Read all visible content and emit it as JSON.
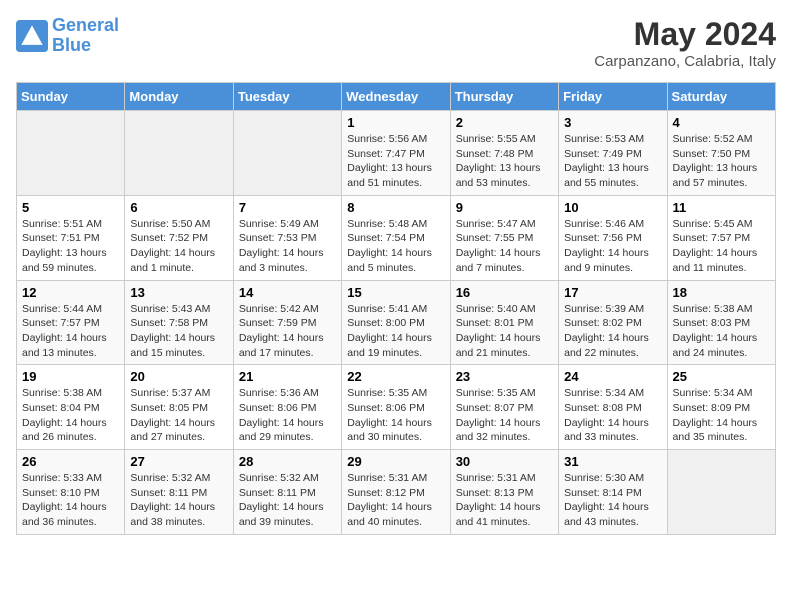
{
  "header": {
    "logo_line1": "General",
    "logo_line2": "Blue",
    "month_title": "May 2024",
    "location": "Carpanzano, Calabria, Italy"
  },
  "calendar": {
    "days_of_week": [
      "Sunday",
      "Monday",
      "Tuesday",
      "Wednesday",
      "Thursday",
      "Friday",
      "Saturday"
    ],
    "weeks": [
      [
        {
          "day": null,
          "info": null
        },
        {
          "day": null,
          "info": null
        },
        {
          "day": null,
          "info": null
        },
        {
          "day": "1",
          "info": "Sunrise: 5:56 AM\nSunset: 7:47 PM\nDaylight: 13 hours\nand 51 minutes."
        },
        {
          "day": "2",
          "info": "Sunrise: 5:55 AM\nSunset: 7:48 PM\nDaylight: 13 hours\nand 53 minutes."
        },
        {
          "day": "3",
          "info": "Sunrise: 5:53 AM\nSunset: 7:49 PM\nDaylight: 13 hours\nand 55 minutes."
        },
        {
          "day": "4",
          "info": "Sunrise: 5:52 AM\nSunset: 7:50 PM\nDaylight: 13 hours\nand 57 minutes."
        }
      ],
      [
        {
          "day": "5",
          "info": "Sunrise: 5:51 AM\nSunset: 7:51 PM\nDaylight: 13 hours\nand 59 minutes."
        },
        {
          "day": "6",
          "info": "Sunrise: 5:50 AM\nSunset: 7:52 PM\nDaylight: 14 hours\nand 1 minute."
        },
        {
          "day": "7",
          "info": "Sunrise: 5:49 AM\nSunset: 7:53 PM\nDaylight: 14 hours\nand 3 minutes."
        },
        {
          "day": "8",
          "info": "Sunrise: 5:48 AM\nSunset: 7:54 PM\nDaylight: 14 hours\nand 5 minutes."
        },
        {
          "day": "9",
          "info": "Sunrise: 5:47 AM\nSunset: 7:55 PM\nDaylight: 14 hours\nand 7 minutes."
        },
        {
          "day": "10",
          "info": "Sunrise: 5:46 AM\nSunset: 7:56 PM\nDaylight: 14 hours\nand 9 minutes."
        },
        {
          "day": "11",
          "info": "Sunrise: 5:45 AM\nSunset: 7:57 PM\nDaylight: 14 hours\nand 11 minutes."
        }
      ],
      [
        {
          "day": "12",
          "info": "Sunrise: 5:44 AM\nSunset: 7:57 PM\nDaylight: 14 hours\nand 13 minutes."
        },
        {
          "day": "13",
          "info": "Sunrise: 5:43 AM\nSunset: 7:58 PM\nDaylight: 14 hours\nand 15 minutes."
        },
        {
          "day": "14",
          "info": "Sunrise: 5:42 AM\nSunset: 7:59 PM\nDaylight: 14 hours\nand 17 minutes."
        },
        {
          "day": "15",
          "info": "Sunrise: 5:41 AM\nSunset: 8:00 PM\nDaylight: 14 hours\nand 19 minutes."
        },
        {
          "day": "16",
          "info": "Sunrise: 5:40 AM\nSunset: 8:01 PM\nDaylight: 14 hours\nand 21 minutes."
        },
        {
          "day": "17",
          "info": "Sunrise: 5:39 AM\nSunset: 8:02 PM\nDaylight: 14 hours\nand 22 minutes."
        },
        {
          "day": "18",
          "info": "Sunrise: 5:38 AM\nSunset: 8:03 PM\nDaylight: 14 hours\nand 24 minutes."
        }
      ],
      [
        {
          "day": "19",
          "info": "Sunrise: 5:38 AM\nSunset: 8:04 PM\nDaylight: 14 hours\nand 26 minutes."
        },
        {
          "day": "20",
          "info": "Sunrise: 5:37 AM\nSunset: 8:05 PM\nDaylight: 14 hours\nand 27 minutes."
        },
        {
          "day": "21",
          "info": "Sunrise: 5:36 AM\nSunset: 8:06 PM\nDaylight: 14 hours\nand 29 minutes."
        },
        {
          "day": "22",
          "info": "Sunrise: 5:35 AM\nSunset: 8:06 PM\nDaylight: 14 hours\nand 30 minutes."
        },
        {
          "day": "23",
          "info": "Sunrise: 5:35 AM\nSunset: 8:07 PM\nDaylight: 14 hours\nand 32 minutes."
        },
        {
          "day": "24",
          "info": "Sunrise: 5:34 AM\nSunset: 8:08 PM\nDaylight: 14 hours\nand 33 minutes."
        },
        {
          "day": "25",
          "info": "Sunrise: 5:34 AM\nSunset: 8:09 PM\nDaylight: 14 hours\nand 35 minutes."
        }
      ],
      [
        {
          "day": "26",
          "info": "Sunrise: 5:33 AM\nSunset: 8:10 PM\nDaylight: 14 hours\nand 36 minutes."
        },
        {
          "day": "27",
          "info": "Sunrise: 5:32 AM\nSunset: 8:11 PM\nDaylight: 14 hours\nand 38 minutes."
        },
        {
          "day": "28",
          "info": "Sunrise: 5:32 AM\nSunset: 8:11 PM\nDaylight: 14 hours\nand 39 minutes."
        },
        {
          "day": "29",
          "info": "Sunrise: 5:31 AM\nSunset: 8:12 PM\nDaylight: 14 hours\nand 40 minutes."
        },
        {
          "day": "30",
          "info": "Sunrise: 5:31 AM\nSunset: 8:13 PM\nDaylight: 14 hours\nand 41 minutes."
        },
        {
          "day": "31",
          "info": "Sunrise: 5:30 AM\nSunset: 8:14 PM\nDaylight: 14 hours\nand 43 minutes."
        },
        {
          "day": null,
          "info": null
        }
      ]
    ]
  }
}
